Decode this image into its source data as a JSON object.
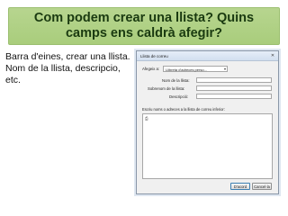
{
  "slide": {
    "title": "Com podem crear una llista? Quins camps ens caldrà afegir?",
    "body_lines": [
      "Barra d'eines, crear una llista.",
      "Nom de la llista, descripcio,",
      "etc."
    ]
  },
  "dialog": {
    "title": "Llista de correu",
    "close_symbol": "✕",
    "add_to_label": "Afegeix a:",
    "add_to_value": "Llibreta d'adreces perso...",
    "dropdown_arrow": "▾",
    "list_name_label": "Nom de la llista:",
    "list_nickname_label": "Sobrenom de la llista:",
    "description_label": "Descripció:",
    "addresses_label": "Escriu noms o adreces a la llista de correu inferior:",
    "addresses_icon": "⎙",
    "ok_button": "D'acord",
    "cancel_button": "Cancel·la"
  },
  "colors": {
    "title_bar_bg": "#afd184",
    "title_text": "#1a3a10",
    "dialog_bg": "#f0f0f0",
    "dialog_titlebar": "#d9e4f2"
  }
}
